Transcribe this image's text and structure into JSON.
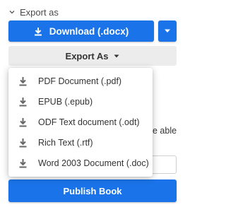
{
  "section": {
    "title": "Export as"
  },
  "download": {
    "label": "Download (.docx)"
  },
  "export_as": {
    "label": "Export As"
  },
  "menu": {
    "items": [
      {
        "label": "PDF Document (.pdf)"
      },
      {
        "label": "EPUB (.epub)"
      },
      {
        "label": "ODF Text document (.odt)"
      },
      {
        "label": "Rich Text (.rtf)"
      },
      {
        "label": "Word 2003 Document (.doc)"
      }
    ]
  },
  "background": {
    "partial_text": "e able"
  },
  "publish": {
    "label": "Publish Book"
  },
  "colors": {
    "primary": "#1a73e8",
    "secondary_bg": "#ececec",
    "text": "#333333"
  }
}
